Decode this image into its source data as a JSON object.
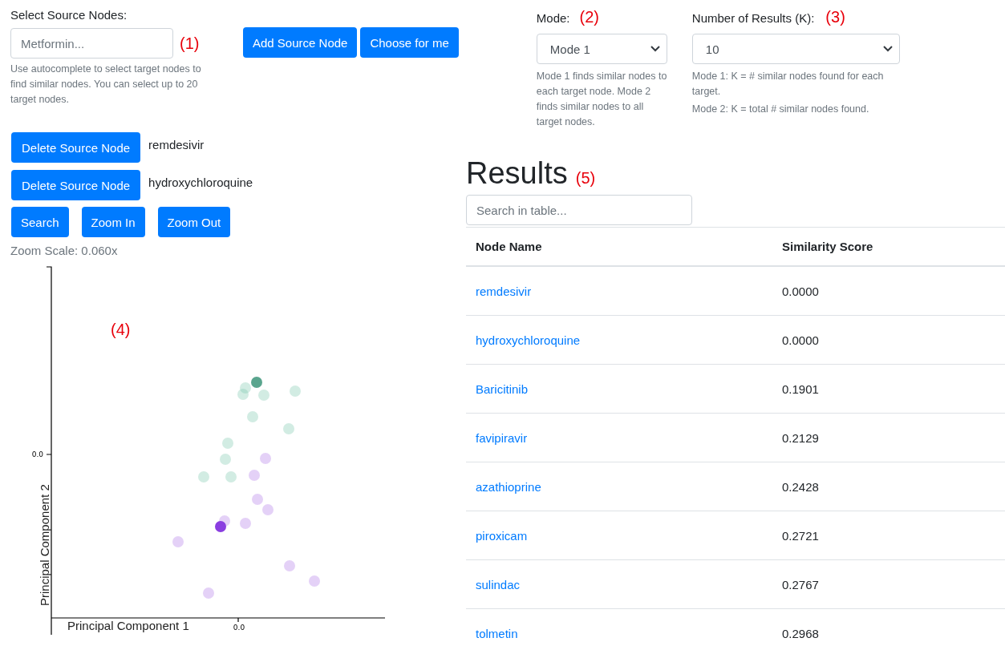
{
  "source": {
    "label": "Select Source Nodes:",
    "placeholder": "Metformin...",
    "annotation": "(1)",
    "help": "Use autocomplete to select target nodes to find similar nodes. You can select up to 20 target nodes.",
    "buttons": [
      "Add Source Node",
      "Choose for me"
    ]
  },
  "mode": {
    "label": "Mode:",
    "annotation": "(2)",
    "value": "Mode 1",
    "help": [
      "Mode 1 finds similar nodes to each target node. Mode 2 finds similar nodes to all target nodes."
    ]
  },
  "k": {
    "label": "Number of Results (K):",
    "annotation": "(3)",
    "value": "10",
    "help": [
      "Mode 1: K = # similar nodes found for each target.",
      "Mode 2: K = total # similar nodes found."
    ]
  },
  "selected_nodes": [
    {
      "button": "Delete Source Node",
      "name": "remdesivir"
    },
    {
      "button": "Delete Source Node",
      "name": "hydroxychloroquine"
    }
  ],
  "actions": [
    "Search",
    "Zoom In",
    "Zoom Out"
  ],
  "zoom_scale": "Zoom Scale: 0.060x",
  "plot": {
    "annotation": "(4)",
    "xlabel": "Principal Component 1",
    "ylabel": "Principal Component 2",
    "x_tick": "0.0",
    "y_tick": "0.0"
  },
  "results": {
    "title": "Results",
    "annotation": "(5)",
    "search_placeholder": "Search in table...",
    "columns": [
      "Node Name",
      "Similarity Score"
    ],
    "rows": [
      [
        "remdesivir",
        "0.0000"
      ],
      [
        "hydroxychloroquine",
        "0.0000"
      ],
      [
        "Baricitinib",
        "0.1901"
      ],
      [
        "favipiravir",
        "0.2129"
      ],
      [
        "azathioprine",
        "0.2428"
      ],
      [
        "piroxicam",
        "0.2721"
      ],
      [
        "sulindac",
        "0.2767"
      ],
      [
        "tolmetin",
        "0.2968"
      ]
    ]
  }
}
